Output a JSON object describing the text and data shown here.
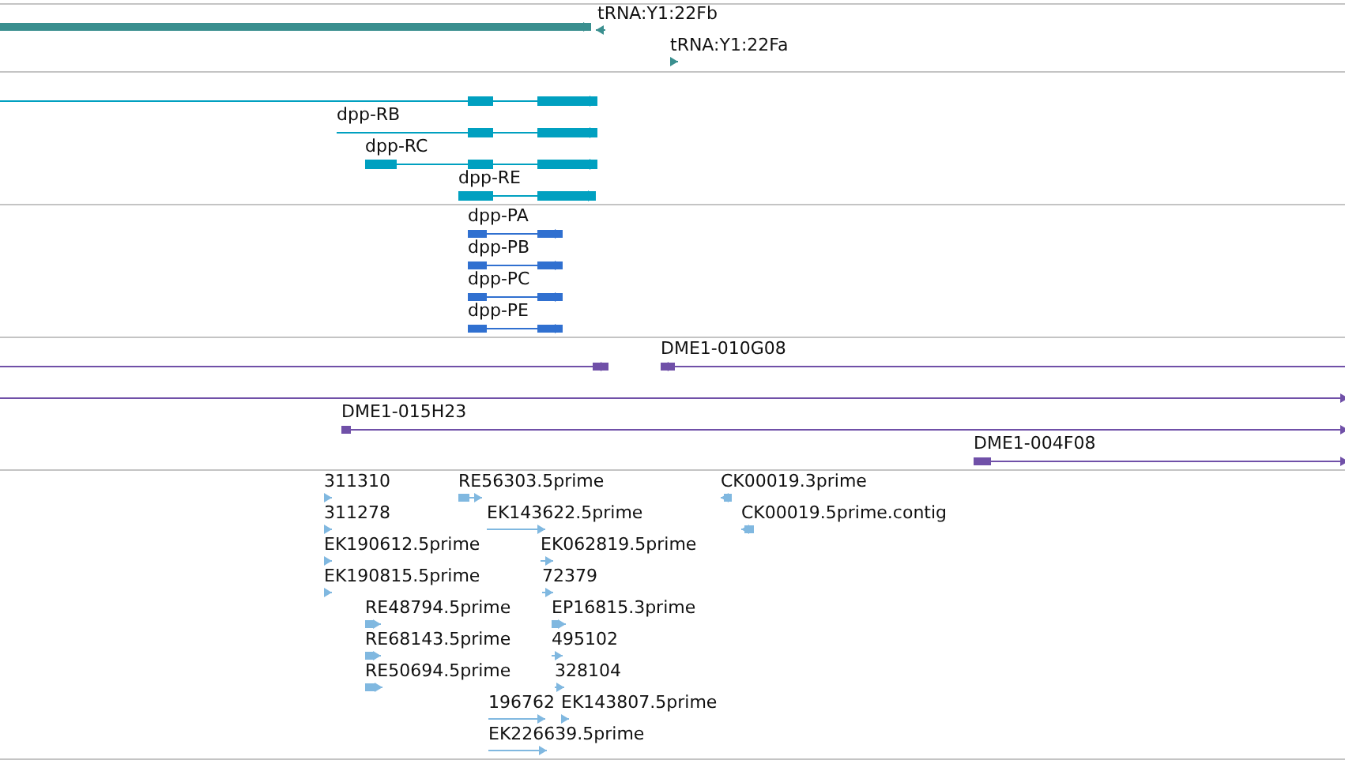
{
  "tracks": [
    {
      "color": "#3a8f8f",
      "features": [
        {
          "kind": "forward"
        },
        {
          "label": "tRNA:Y1:22Fb",
          "kind": "reverse"
        },
        {
          "label": "tRNA:Y1:22Fa",
          "kind": "forward"
        }
      ]
    },
    {
      "color": "#00a0c0",
      "features": [
        {
          "kind": "forward"
        },
        {
          "label": "dpp-RB",
          "kind": "forward"
        },
        {
          "label": "dpp-RC",
          "kind": "forward"
        },
        {
          "label": "dpp-RE",
          "kind": "forward"
        }
      ]
    },
    {
      "color": "#3070d0",
      "features": [
        {
          "label": "dpp-PA",
          "kind": "forward"
        },
        {
          "label": "dpp-PB",
          "kind": "forward"
        },
        {
          "label": "dpp-PC",
          "kind": "forward"
        },
        {
          "label": "dpp-PE",
          "kind": "forward"
        }
      ]
    },
    {
      "color": "#7050a8",
      "features": [
        {
          "kind": "forward"
        },
        {
          "label": "DME1-010G08",
          "kind": "reverse"
        },
        {
          "kind": "forward"
        },
        {
          "label": "DME1-015H23",
          "kind": "forward"
        },
        {
          "label": "DME1-004F08",
          "kind": "forward"
        }
      ]
    },
    {
      "color": "#80b8e0",
      "features": [
        {
          "label": "311310",
          "kind": "forward"
        },
        {
          "label": "311278",
          "kind": "forward"
        },
        {
          "label": "EK190612.5prime",
          "kind": "forward"
        },
        {
          "label": "EK190815.5prime",
          "kind": "forward"
        },
        {
          "label": "RE48794.5prime",
          "kind": "forward"
        },
        {
          "label": "RE68143.5prime",
          "kind": "forward"
        },
        {
          "label": "RE50694.5prime",
          "kind": "forward"
        },
        {
          "label": "RE56303.5prime",
          "kind": "forward"
        },
        {
          "label": "EK143622.5prime",
          "kind": "forward"
        },
        {
          "label": "EK062819.5prime",
          "kind": "forward"
        },
        {
          "label": "72379",
          "kind": "forward"
        },
        {
          "label": "EP16815.3prime",
          "kind": "forward"
        },
        {
          "label": "495102",
          "kind": "forward"
        },
        {
          "label": "328104",
          "kind": "forward"
        },
        {
          "label": "196762",
          "kind": "forward"
        },
        {
          "label": "EK143807.5prime",
          "kind": "forward"
        },
        {
          "label": "EK226639.5prime",
          "kind": "forward"
        },
        {
          "label": "CK00019.3prime",
          "kind": "reverse"
        },
        {
          "label": "CK00019.5prime.contig",
          "kind": "reverse"
        }
      ]
    }
  ]
}
